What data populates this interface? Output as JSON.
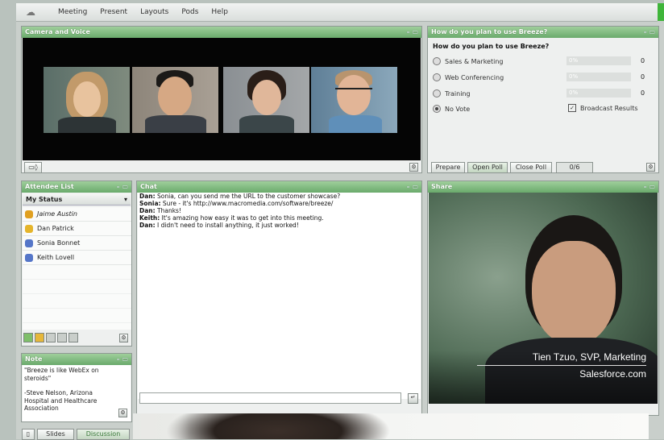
{
  "menu": {
    "items": [
      "Meeting",
      "Present",
      "Layouts",
      "Pods",
      "Help"
    ]
  },
  "camera_pod": {
    "title": "Camera and Voice"
  },
  "poll_pod": {
    "title": "How do you plan to use Breeze?",
    "question": "How do you plan to use Breeze?",
    "options": [
      {
        "label": "Sales & Marketing",
        "percent_text": "0%",
        "count": "0"
      },
      {
        "label": "Web Conferencing",
        "percent_text": "0%",
        "count": "0"
      },
      {
        "label": "Training",
        "percent_text": "0%",
        "count": "0"
      },
      {
        "label": "No Vote"
      }
    ],
    "broadcast_label": "Broadcast Results",
    "buttons": {
      "prepare": "Prepare",
      "open": "Open Poll",
      "close": "Close Poll"
    },
    "vote_count": "0/6"
  },
  "attendee_pod": {
    "title": "Attendee List",
    "status_label": "My Status",
    "attendees": [
      "Jaime Austin",
      "Dan Patrick",
      "Sonia Bonnet",
      "Keith Lovell"
    ]
  },
  "note_pod": {
    "title": "Note",
    "text_line1": "\"Breeze is like WebEx on",
    "text_line2": "steroids\"",
    "text_line3": "-Steve Nelson, Arizona",
    "text_line4": "Hospital and Healthcare",
    "text_line5": "Association"
  },
  "chat_pod": {
    "title": "Chat",
    "messages": [
      {
        "sender": "Dan:",
        "text": " Sonia, can you send me the URL to the customer showcase?"
      },
      {
        "sender": "Sonia:",
        "text": " Sure - it's http://www.macromedia.com/software/breeze/"
      },
      {
        "sender": "Dan:",
        "text": " Thanks!"
      },
      {
        "sender": "Keith:",
        "text": " It's amazing how easy it was to get into this meeting."
      },
      {
        "sender": "Dan:",
        "text": " I didn't need to install anything, it just worked!"
      }
    ]
  },
  "share_pod": {
    "title": "Share",
    "caption_name": "Tien Tzuo, SVP, Marketing",
    "caption_company": "Salesforce.com"
  },
  "bottom_tabs": {
    "slides": "Slides",
    "discussion": "Discussion"
  },
  "colors": {
    "pod_title": "#7fbd7f",
    "accent_green": "#3fb53a"
  }
}
